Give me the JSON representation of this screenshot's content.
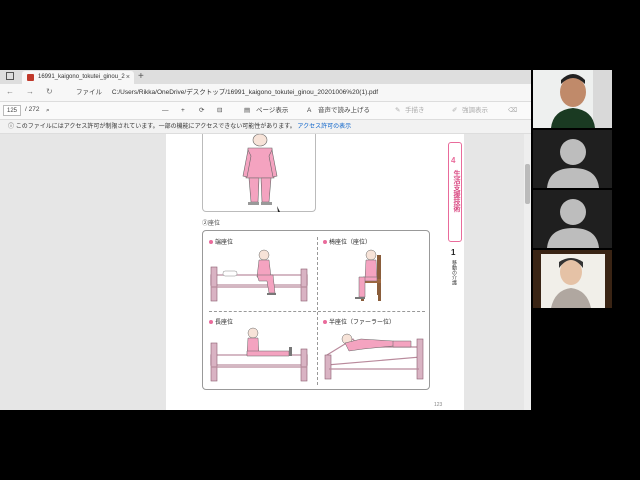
{
  "browser": {
    "tab_title": "16991_kaigono_tokutei_ginou_2",
    "tab_close": "×",
    "new_tab": "+",
    "file_label": "ファイル",
    "url": "C:/Users/Rikka/OneDrive/デスクトップ/16991_kaigono_tokutei_ginou_20201006%20(1).pdf"
  },
  "pdf_toolbar": {
    "current_page": "125",
    "total_pages": "/ 272",
    "zoom_out": "—",
    "zoom_in": "+",
    "page_view": "ページ表示",
    "read_aloud": "音声で読み上げる",
    "draw": "手描き",
    "highlight": "強調表示"
  },
  "notice": {
    "text": "このファイルにはアクセス許可が制限されています。一部の機能にアクセスできない可能性があります。",
    "link": "アクセス許可の表示"
  },
  "document": {
    "caption": "②座位",
    "cells": [
      {
        "label": "端座位"
      },
      {
        "label": "椅座位（座位）"
      },
      {
        "label": "長座位"
      },
      {
        "label": "半座位（ファーラー位）"
      }
    ],
    "side_number": "4",
    "side_title": "生活支援技術",
    "side_number2": "1",
    "side_subtitle": "移動の介護",
    "page_number": "123"
  },
  "colors": {
    "accent_pink": "#e96b9b",
    "figure_pink": "#f4a3c0",
    "bed_frame": "#b98a9c"
  }
}
